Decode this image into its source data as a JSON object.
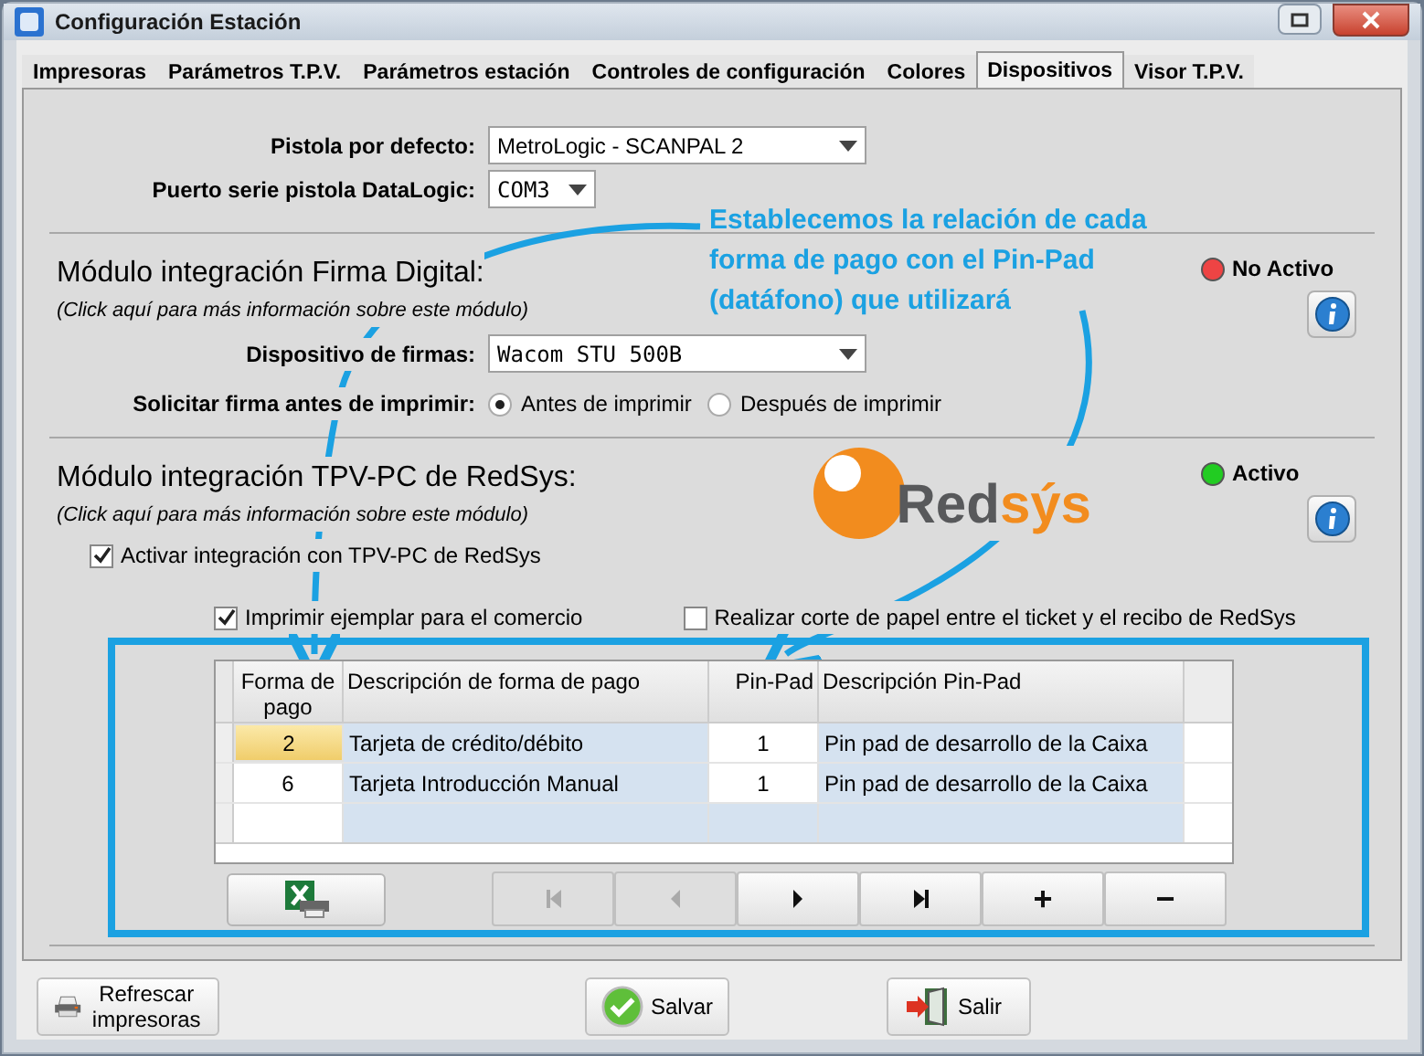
{
  "window": {
    "title": "Configuración Estación"
  },
  "tabs": [
    {
      "label": "Impresoras",
      "selected": false
    },
    {
      "label": "Parámetros T.P.V.",
      "selected": false
    },
    {
      "label": "Parámetros estación",
      "selected": false
    },
    {
      "label": "Controles de configuración",
      "selected": false
    },
    {
      "label": "Colores",
      "selected": false
    },
    {
      "label": "Dispositivos",
      "selected": true
    },
    {
      "label": "Visor T.P.V.",
      "selected": false
    }
  ],
  "scanner": {
    "default_label": "Pistola por defecto:",
    "default_value": "MetroLogic - SCANPAL 2",
    "port_label": "Puerto serie pistola DataLogic:",
    "port_value": "COM3"
  },
  "signature_module": {
    "title": "Módulo integración Firma Digital:",
    "subtitle": "(Click aquí para más información sobre este módulo)",
    "status": {
      "label": "No Activo",
      "active": false
    },
    "device_label": "Dispositivo de firmas:",
    "device_value": "Wacom STU 500B",
    "ask_label": "Solicitar firma antes de imprimir:",
    "options": [
      {
        "label": "Antes de imprimir",
        "selected": true
      },
      {
        "label": "Después de imprimir",
        "selected": false
      }
    ]
  },
  "redsys_module": {
    "title": "Módulo integración TPV-PC de RedSys:",
    "subtitle": "(Click aquí para más información sobre este módulo)",
    "status": {
      "label": "Activo",
      "active": true
    },
    "logo": {
      "part_1": "Red",
      "part_2": "sýs"
    },
    "enable": {
      "label": "Activar integración con TPV-PC de RedSys",
      "checked": true
    },
    "options": [
      {
        "label": "Imprimir ejemplar para el comercio",
        "checked": true
      },
      {
        "label": "Realizar corte de papel entre el ticket y el recibo de RedSys",
        "checked": false
      }
    ]
  },
  "table": {
    "columns": [
      "Forma de pago",
      "Descripción de forma de pago",
      "Pin-Pad",
      "Descripción Pin-Pad"
    ],
    "rows": [
      {
        "selected": true,
        "cells": [
          "2",
          "Tarjeta de crédito/débito",
          "1",
          "Pin pad de desarrollo de la Caixa"
        ]
      },
      {
        "selected": false,
        "cells": [
          "6",
          "Tarjeta Introducción Manual",
          "1",
          "Pin pad de desarrollo de la Caixa"
        ]
      }
    ]
  },
  "navigator": [
    {
      "kind": "first",
      "disabled": true
    },
    {
      "kind": "prev",
      "disabled": true
    },
    {
      "kind": "next",
      "disabled": false
    },
    {
      "kind": "last",
      "disabled": false
    },
    {
      "kind": "add",
      "label": "+",
      "disabled": false
    },
    {
      "kind": "remove",
      "label": "−",
      "disabled": false
    }
  ],
  "footer_buttons": [
    {
      "kind": "printer",
      "label": "Refrescar impresoras"
    },
    {
      "kind": "save",
      "label": "Salvar"
    },
    {
      "kind": "exit",
      "label": "Salir"
    }
  ],
  "annotation": "Establecemos la relación de cada forma de pago con el Pin-Pad (datáfono) que utilizará"
}
